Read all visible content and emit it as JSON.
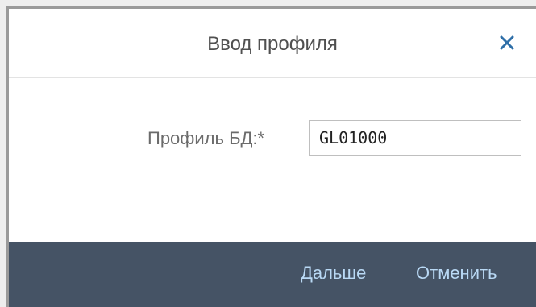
{
  "dialog": {
    "title": "Ввод профиля",
    "close_icon": "close-icon"
  },
  "form": {
    "db_profile_label": "Профиль БД:",
    "required_marker": "*",
    "db_profile_value": "GL01000"
  },
  "footer": {
    "next_label": "Дальше",
    "cancel_label": "Отменить"
  },
  "colors": {
    "footer_bg": "#455365",
    "footer_link": "#b9d9f5",
    "close_icon": "#2f6fa8"
  }
}
